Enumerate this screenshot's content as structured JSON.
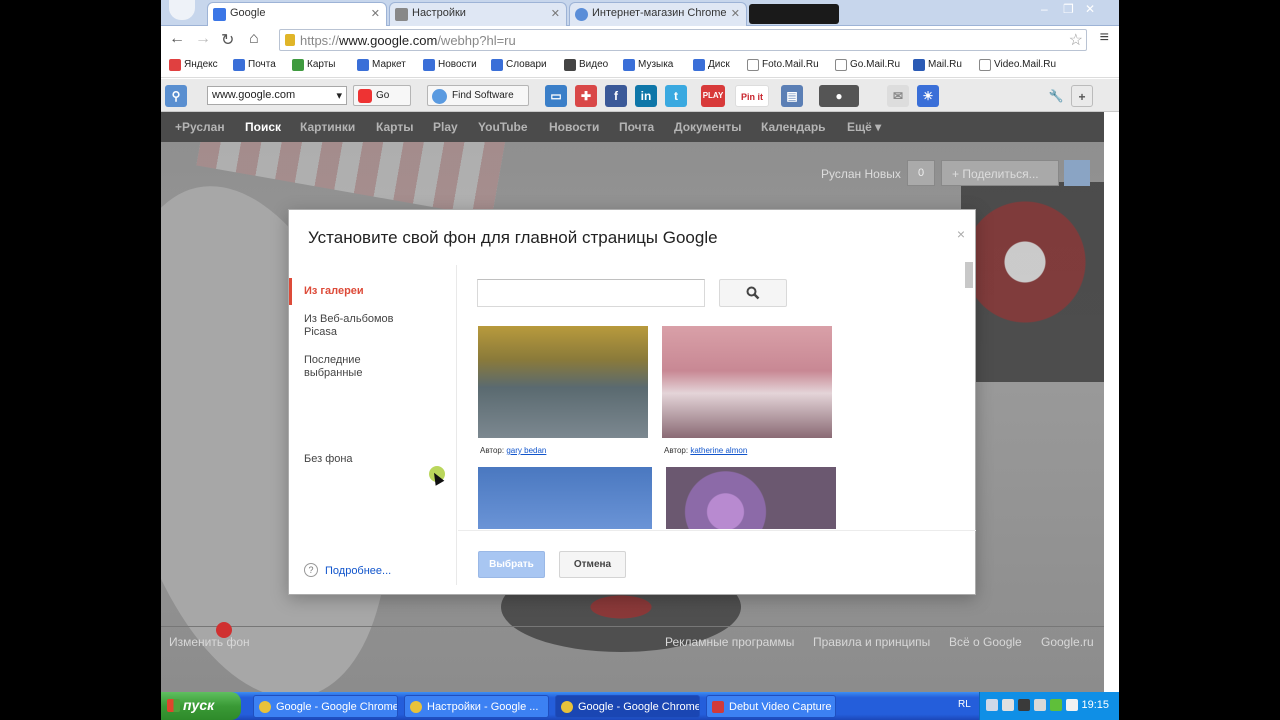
{
  "browser": {
    "tabs": [
      {
        "label": "Google",
        "active": true
      },
      {
        "label": "Настройки",
        "active": false
      },
      {
        "label": "Интернет-магазин Chrome",
        "active": false
      }
    ],
    "url_scheme": "https://",
    "url_host": "www.google.com",
    "url_path": "/webhp?hl=ru",
    "bookmarks": [
      "Яндекс",
      "Почта",
      "Карты",
      "Маркет",
      "Новости",
      "Словари",
      "Видео",
      "Музыка",
      "Диск",
      "Foto.Mail.Ru",
      "Go.Mail.Ru",
      "Mail.Ru",
      "Video.Mail.Ru"
    ]
  },
  "toolbar": {
    "site_select": "www.google.com",
    "go_label": "Go",
    "find_software_label": "Find Software",
    "play_label": "PLAY",
    "pinit_label": "Pin it"
  },
  "google_bar": {
    "items": [
      "+Руслан",
      "Поиск",
      "Картинки",
      "Карты",
      "Play",
      "YouTube",
      "Новости",
      "Почта",
      "Документы",
      "Календарь",
      "Ещё"
    ],
    "more_arrow": "▾"
  },
  "page": {
    "user_name": "Руслан Новых",
    "notifications_count": "0",
    "share_label": "Поделиться...",
    "footer_left": "Изменить фон",
    "footer_links": [
      "Рекламные программы",
      "Правила и принципы",
      "Всё о Google",
      "Google.ru"
    ]
  },
  "dialog": {
    "title": "Установите свой фон для главной страницы Google",
    "close": "×",
    "side_items": [
      "Из галереи",
      "Из Веб-альбомов Picasa",
      "Последние выбранные",
      "Без фона"
    ],
    "help_link": "Подробнее...",
    "search_placeholder": "",
    "author_prefix": "Автор:",
    "photos": [
      {
        "author": "gary bedan",
        "icon": "hippos-photo"
      },
      {
        "author": "katherine almon",
        "icon": "pier-photo"
      },
      {
        "author": "",
        "icon": "bridge-photo"
      },
      {
        "author": "",
        "icon": "hummingbird-photo"
      }
    ],
    "select_button": "Выбрать",
    "cancel_button": "Отмена"
  },
  "taskbar": {
    "start_label": "пуск",
    "tasks": [
      "Google - Google Chrome",
      "Настройки - Google ...",
      "Google - Google Chrome",
      "Debut Video Capture ..."
    ],
    "language": "RL",
    "time": "19:15"
  },
  "colors": {
    "accent_red": "#dd4b39",
    "link_blue": "#1155cc",
    "gbar_bg": "#4b4b4b",
    "xp_blue": "#245edb"
  }
}
